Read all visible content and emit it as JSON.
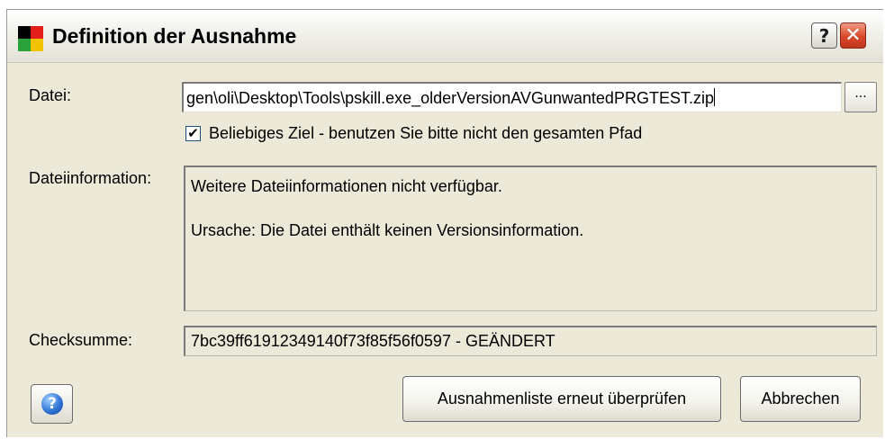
{
  "window": {
    "title": "Definition der Ausnahme",
    "help_glyph": "?",
    "close_glyph": "✕"
  },
  "form": {
    "file_label": "Datei:",
    "file_value": "gen\\oli\\Desktop\\Tools\\pskill.exe_olderVersionAVGunwantedPRGTEST.zip",
    "browse_label": "...",
    "any_target_checked": true,
    "any_target_label": "Beliebiges Ziel - benutzen Sie bitte nicht den gesamten Pfad",
    "fileinfo_label": "Dateiinformation:",
    "fileinfo_line1": "Weitere Dateiinformationen nicht verfügbar.",
    "fileinfo_line2": "Ursache: Die Datei enthält keinen Versionsinformation.",
    "checksum_label": "Checksumme:",
    "checksum_value": "7bc39ff61912349140f73f85f56f0597 - GEÄNDERT"
  },
  "buttons": {
    "help_icon_glyph": "?",
    "recheck_label": "Ausnahmenliste erneut überprüfen",
    "cancel_label": "Abbrechen"
  },
  "colors": {
    "dialog_bg": "#ece9d8",
    "close_button": "#d9482b",
    "help_circle": "#2a6fd0"
  },
  "icons": {
    "app_icon": "avg-four-color-icon",
    "help_button_icon": "help-circle-icon",
    "checkbox_mark": "checkmark-icon"
  }
}
